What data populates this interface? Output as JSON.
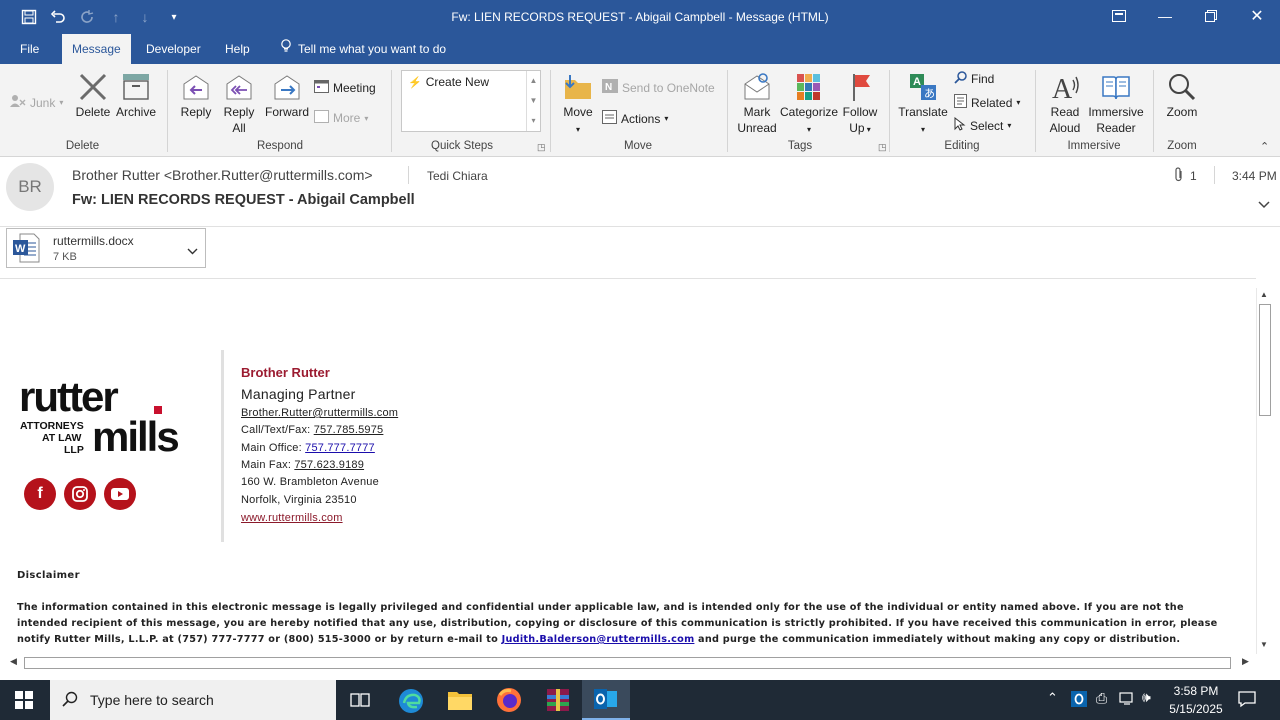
{
  "window": {
    "title": "Fw: LIEN RECORDS REQUEST - Abigail Campbell  -  Message (HTML)"
  },
  "menu": {
    "tabs": [
      "File",
      "Message",
      "Developer",
      "Help"
    ],
    "tell_me": "Tell me what you want to do"
  },
  "ribbon": {
    "junk": "Junk",
    "delete": "Delete",
    "archive": "Archive",
    "reply": "Reply",
    "reply_all_1": "Reply",
    "reply_all_2": "All",
    "forward": "Forward",
    "meeting": "Meeting",
    "more": "More",
    "create_new": "Create New",
    "move": "Move",
    "send_onenote": "Send to OneNote",
    "actions": "Actions",
    "mark_unread_1": "Mark",
    "mark_unread_2": "Unread",
    "categorize": "Categorize",
    "follow_up_1": "Follow",
    "follow_up_2": "Up",
    "translate": "Translate",
    "find": "Find",
    "related": "Related",
    "select": "Select",
    "read_aloud_1": "Read",
    "read_aloud_2": "Aloud",
    "immersive_1": "Immersive",
    "immersive_2": "Reader",
    "zoom": "Zoom",
    "groups": {
      "delete": "Delete",
      "respond": "Respond",
      "quick_steps": "Quick Steps",
      "move": "Move",
      "tags": "Tags",
      "editing": "Editing",
      "immersive": "Immersive",
      "zoom": "Zoom"
    }
  },
  "message": {
    "avatar_initials": "BR",
    "from": "Brother Rutter <Brother.Rutter@ruttermills.com>",
    "to": "Tedi Chiara",
    "subject": "Fw: LIEN RECORDS REQUEST - Abigail Campbell",
    "attachment_count": "1",
    "time": "3:44 PM"
  },
  "attachment": {
    "name": "ruttermills.docx",
    "size": "7 KB"
  },
  "signature": {
    "logo_line1": "rutter",
    "logo_left1": "ATTORNEYS",
    "logo_left2": "AT LAW",
    "logo_left3": "LLP",
    "logo_line2": "mills",
    "name": "Brother Rutter",
    "role": "Managing Partner",
    "email": "Brother.Rutter@ruttermills.com",
    "call_label": "Call/Text/Fax: ",
    "call": "757.785.5975",
    "office_label": "Main Office: ",
    "office": "757.777.7777",
    "fax_label": "Main Fax: ",
    "fax": "757.623.9189",
    "addr1": "160 W. Brambleton Avenue",
    "addr2": "Norfolk, Virginia 23510",
    "web": "www.ruttermills.com"
  },
  "disclaimer": {
    "title": "Disclaimer",
    "line1": "The information contained in this electronic message is legally privileged and confidential under applicable law, and is intended only for the use of the individual or entity named above. If you are not the",
    "line2": "intended recipient of this message, you are hereby notified that any use, distribution, copying or disclosure of this communication is strictly prohibited. If you have received this communication in error, please",
    "line3a": "notify Rutter Mills, L.L.P. at (757) 777-7777 or (800)  515-3000 or by return e-mail to ",
    "line3_email": "Judith.Balderson@ruttermills.com",
    "line3b": " and purge the communication immediately without making any copy or distribution."
  },
  "taskbar": {
    "search_placeholder": "Type here to search",
    "time": "3:58 PM",
    "date": "5/15/2025"
  },
  "colors": {
    "accent": "#2b579a",
    "brand_red": "#b5121b",
    "taskbar": "#1f2a36"
  }
}
